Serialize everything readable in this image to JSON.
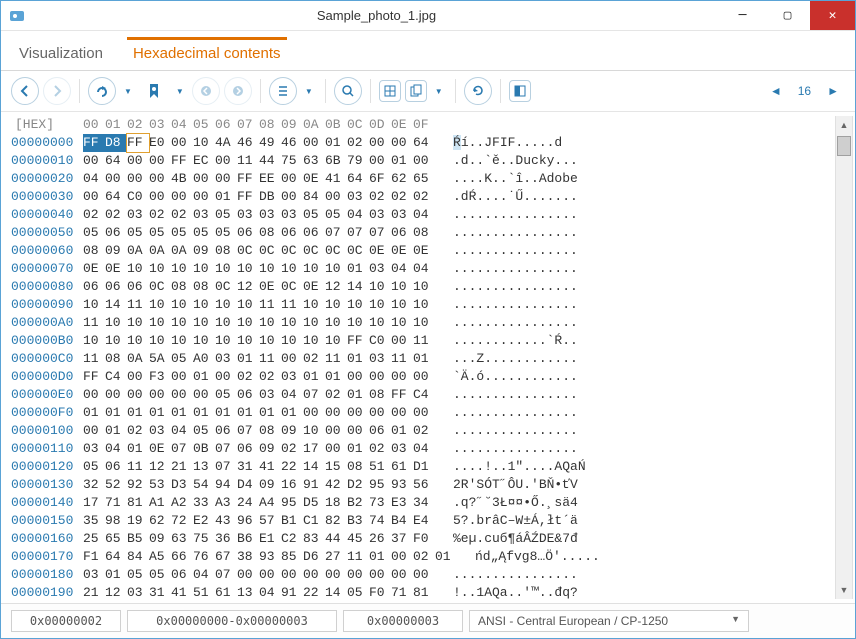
{
  "title": "Sample_photo_1.jpg",
  "tabs": {
    "vis": "Visualization",
    "hex": "Hexadecimal contents"
  },
  "hex_label": "[HEX]",
  "page_indicator": "16",
  "columns": [
    "00",
    "01",
    "02",
    "03",
    "04",
    "05",
    "06",
    "07",
    "08",
    "09",
    "0A",
    "0B",
    "0C",
    "0D",
    "0E",
    "0F"
  ],
  "selection": {
    "start": 0,
    "end": 2,
    "cursor": 2
  },
  "rows": [
    {
      "offset": "00000000",
      "bytes": [
        "FF",
        "D8",
        "FF",
        "E0",
        "00",
        "10",
        "4A",
        "46",
        "49",
        "46",
        "00",
        "01",
        "02",
        "00",
        "00",
        "64"
      ],
      "ascii": "Ŕí..JFIF.....d"
    },
    {
      "offset": "00000010",
      "bytes": [
        "00",
        "64",
        "00",
        "00",
        "FF",
        "EC",
        "00",
        "11",
        "44",
        "75",
        "63",
        "6B",
        "79",
        "00",
        "01",
        "00"
      ],
      "ascii": ".d..`ě..Ducky..."
    },
    {
      "offset": "00000020",
      "bytes": [
        "04",
        "00",
        "00",
        "00",
        "4B",
        "00",
        "00",
        "FF",
        "EE",
        "00",
        "0E",
        "41",
        "64",
        "6F",
        "62",
        "65"
      ],
      "ascii": "....K..`î..Adobe"
    },
    {
      "offset": "00000030",
      "bytes": [
        "00",
        "64",
        "C0",
        "00",
        "00",
        "00",
        "01",
        "FF",
        "DB",
        "00",
        "84",
        "00",
        "03",
        "02",
        "02",
        "02"
      ],
      "ascii": ".dŔ....˙Ű......."
    },
    {
      "offset": "00000040",
      "bytes": [
        "02",
        "02",
        "03",
        "02",
        "02",
        "03",
        "05",
        "03",
        "03",
        "03",
        "05",
        "05",
        "04",
        "03",
        "03",
        "04"
      ],
      "ascii": "................"
    },
    {
      "offset": "00000050",
      "bytes": [
        "05",
        "06",
        "05",
        "05",
        "05",
        "05",
        "05",
        "06",
        "08",
        "06",
        "06",
        "07",
        "07",
        "07",
        "06",
        "08"
      ],
      "ascii": "................"
    },
    {
      "offset": "00000060",
      "bytes": [
        "08",
        "09",
        "0A",
        "0A",
        "0A",
        "09",
        "08",
        "0C",
        "0C",
        "0C",
        "0C",
        "0C",
        "0C",
        "0E",
        "0E",
        "0E"
      ],
      "ascii": "................"
    },
    {
      "offset": "00000070",
      "bytes": [
        "0E",
        "0E",
        "10",
        "10",
        "10",
        "10",
        "10",
        "10",
        "10",
        "10",
        "10",
        "10",
        "01",
        "03",
        "04",
        "04"
      ],
      "ascii": "................"
    },
    {
      "offset": "00000080",
      "bytes": [
        "06",
        "06",
        "06",
        "0C",
        "08",
        "08",
        "0C",
        "12",
        "0E",
        "0C",
        "0E",
        "12",
        "14",
        "10",
        "10",
        "10"
      ],
      "ascii": "................"
    },
    {
      "offset": "00000090",
      "bytes": [
        "10",
        "14",
        "11",
        "10",
        "10",
        "10",
        "10",
        "10",
        "11",
        "11",
        "10",
        "10",
        "10",
        "10",
        "10",
        "10"
      ],
      "ascii": "................"
    },
    {
      "offset": "000000A0",
      "bytes": [
        "11",
        "10",
        "10",
        "10",
        "10",
        "10",
        "10",
        "10",
        "10",
        "10",
        "10",
        "10",
        "10",
        "10",
        "10",
        "10"
      ],
      "ascii": "................"
    },
    {
      "offset": "000000B0",
      "bytes": [
        "10",
        "10",
        "10",
        "10",
        "10",
        "10",
        "10",
        "10",
        "10",
        "10",
        "10",
        "10",
        "FF",
        "C0",
        "00",
        "11"
      ],
      "ascii": "............`Ŕ.."
    },
    {
      "offset": "000000C0",
      "bytes": [
        "11",
        "08",
        "0A",
        "5A",
        "05",
        "A0",
        "03",
        "01",
        "11",
        "00",
        "02",
        "11",
        "01",
        "03",
        "11",
        "01"
      ],
      "ascii": "...Z............"
    },
    {
      "offset": "000000D0",
      "bytes": [
        "FF",
        "C4",
        "00",
        "F3",
        "00",
        "01",
        "00",
        "02",
        "02",
        "03",
        "01",
        "01",
        "00",
        "00",
        "00",
        "00"
      ],
      "ascii": "`Ä.ó............"
    },
    {
      "offset": "000000E0",
      "bytes": [
        "00",
        "00",
        "00",
        "00",
        "00",
        "00",
        "05",
        "06",
        "03",
        "04",
        "07",
        "02",
        "01",
        "08",
        "FF",
        "C4"
      ],
      "ascii": "................"
    },
    {
      "offset": "000000F0",
      "bytes": [
        "01",
        "01",
        "01",
        "01",
        "01",
        "01",
        "01",
        "01",
        "01",
        "01",
        "00",
        "00",
        "00",
        "00",
        "00",
        "00"
      ],
      "ascii": "................"
    },
    {
      "offset": "00000100",
      "bytes": [
        "00",
        "01",
        "02",
        "03",
        "04",
        "05",
        "06",
        "07",
        "08",
        "09",
        "10",
        "00",
        "00",
        "06",
        "01",
        "02"
      ],
      "ascii": "................"
    },
    {
      "offset": "00000110",
      "bytes": [
        "03",
        "04",
        "01",
        "0E",
        "07",
        "0B",
        "07",
        "06",
        "09",
        "02",
        "17",
        "00",
        "01",
        "02",
        "03",
        "04"
      ],
      "ascii": "................"
    },
    {
      "offset": "00000120",
      "bytes": [
        "05",
        "06",
        "11",
        "12",
        "21",
        "13",
        "07",
        "31",
        "41",
        "22",
        "14",
        "15",
        "08",
        "51",
        "61",
        "D1"
      ],
      "ascii": "....!..1\"....AQaŃ"
    },
    {
      "offset": "00000130",
      "bytes": [
        "32",
        "52",
        "92",
        "53",
        "D3",
        "54",
        "94",
        "D4",
        "09",
        "16",
        "91",
        "42",
        "D2",
        "95",
        "93",
        "56"
      ],
      "ascii": "2R'SÓT˝ÔU.'BŇ•ťV"
    },
    {
      "offset": "00000140",
      "bytes": [
        "17",
        "71",
        "81",
        "A1",
        "A2",
        "33",
        "A3",
        "24",
        "A4",
        "95",
        "D5",
        "18",
        "B2",
        "73",
        "E3",
        "34"
      ],
      "ascii": ".q?˝˘3Ł¤¤•Ő.¸sä4"
    },
    {
      "offset": "00000150",
      "bytes": [
        "35",
        "98",
        "19",
        "62",
        "72",
        "E2",
        "43",
        "96",
        "57",
        "B1",
        "C1",
        "82",
        "B3",
        "74",
        "B4",
        "E4"
      ],
      "ascii": "5?.brâC–W±Á,łt´ä"
    },
    {
      "offset": "00000160",
      "bytes": [
        "25",
        "65",
        "B5",
        "09",
        "63",
        "75",
        "36",
        "B6",
        "E1",
        "C2",
        "83",
        "44",
        "45",
        "26",
        "37",
        "F0"
      ],
      "ascii": "%eµ.cuб¶áÂŹDE&7đ"
    },
    {
      "offset": "00000170",
      "bytes": [
        "F1",
        "64",
        "84",
        "A5",
        "66",
        "76",
        "67",
        "38",
        "93",
        "85",
        "D6",
        "27",
        "11",
        "01",
        "00",
        "02",
        "01"
      ],
      "ascii": "ńd„Ąfvg8…Ö'....."
    },
    {
      "offset": "00000180",
      "bytes": [
        "03",
        "01",
        "05",
        "05",
        "06",
        "04",
        "07",
        "00",
        "00",
        "00",
        "00",
        "00",
        "00",
        "00",
        "00",
        "00"
      ],
      "ascii": "................"
    },
    {
      "offset": "00000190",
      "bytes": [
        "21",
        "12",
        "03",
        "31",
        "41",
        "51",
        "61",
        "13",
        "04",
        "91",
        "22",
        "14",
        "05",
        "F0",
        "71",
        "81"
      ],
      "ascii": "!..1AQa..'™..đq?"
    }
  ],
  "status": {
    "cursor_pos": "0x00000002",
    "sel_range": "0x00000000-0x00000003",
    "sel_len": "0x00000003",
    "encoding": "ANSI - Central European / CP-1250"
  }
}
